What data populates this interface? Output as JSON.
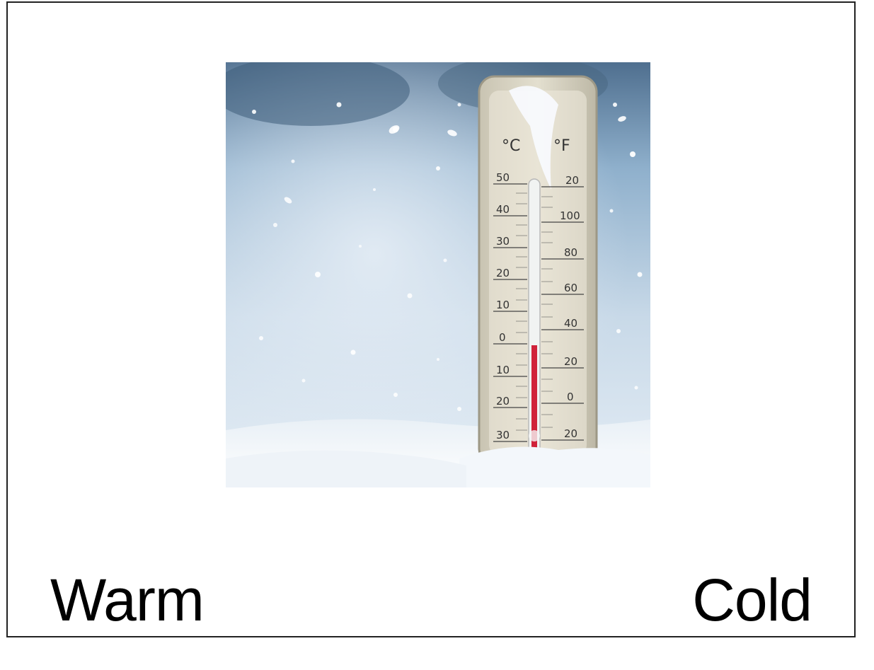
{
  "card": {
    "image": {
      "subject": "thermometer in snow",
      "icon": "thermometer-icon",
      "scale_left_unit": "°C",
      "scale_right_unit": "°F",
      "celsius_labels": [
        "50",
        "40",
        "30",
        "20",
        "10",
        "0",
        "10",
        "20",
        "30"
      ],
      "fahrenheit_labels": [
        "20",
        "100",
        "80",
        "60",
        "40",
        "20",
        "0",
        "20"
      ],
      "mercury_color": "#d0223a",
      "sky_color": "#5e7f9e"
    },
    "options": {
      "left_label": "Warm",
      "right_label": "Cold"
    }
  }
}
